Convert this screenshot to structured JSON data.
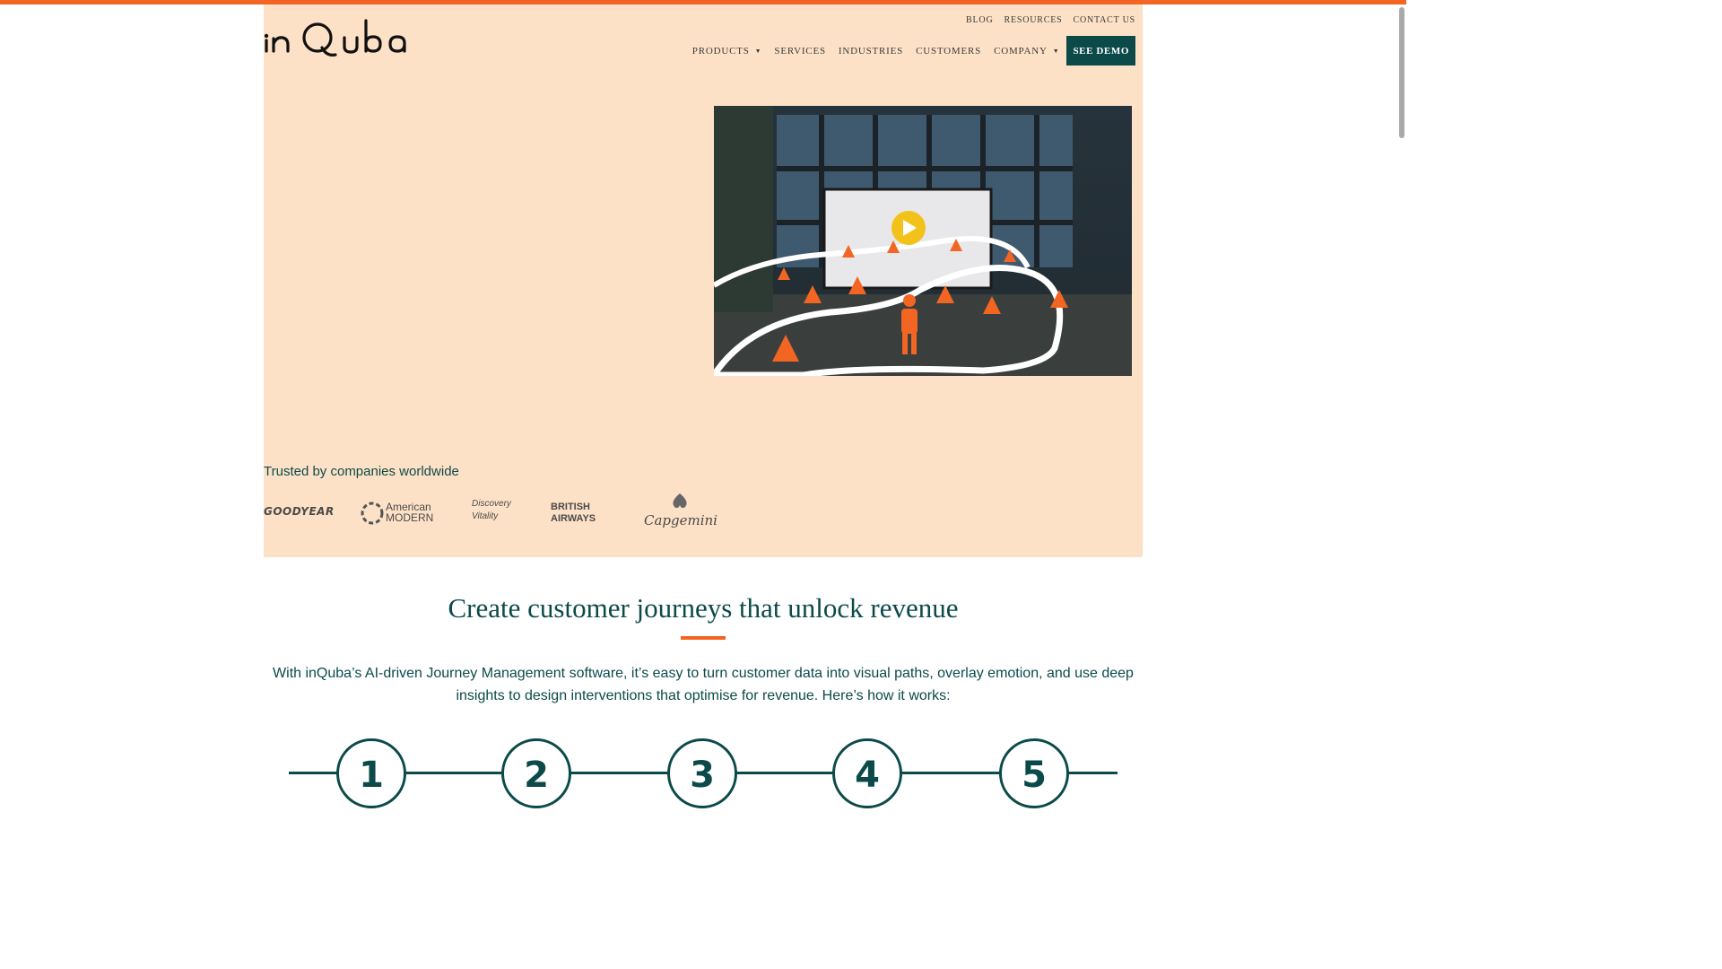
{
  "utility_nav": [
    "BLOG",
    "RESOURCES",
    "CONTACT US"
  ],
  "main_nav": {
    "items": [
      {
        "label": "PRODUCTS",
        "dropdown": true
      },
      {
        "label": "SERVICES",
        "dropdown": false
      },
      {
        "label": "INDUSTRIES",
        "dropdown": false
      },
      {
        "label": "CUSTOMERS",
        "dropdown": false
      },
      {
        "label": "COMPANY",
        "dropdown": true
      }
    ],
    "cta": "SEE DEMO"
  },
  "brand": {
    "name": "inQuba",
    "accent": "#f26522",
    "primary": "#0c4a4a",
    "hero_bg": "#fde1c6"
  },
  "hero": {
    "video": {
      "icon": "play-icon"
    }
  },
  "trusted": {
    "label": "Trusted by companies worldwide",
    "logos": [
      "GOODYEAR",
      "American MODERN",
      "Discovery Vitality",
      "BRITISH AIRWAYS",
      "Capgemini"
    ]
  },
  "section": {
    "title": "Create customer journeys that unlock revenue",
    "description": "With inQuba’s AI-driven Journey Management software, it’s easy to turn customer data into visual paths, overlay emotion, and use deep insights to design interventions that optimise for revenue. Here’s how it works:",
    "steps": [
      "1",
      "2",
      "3",
      "4",
      "5"
    ]
  }
}
